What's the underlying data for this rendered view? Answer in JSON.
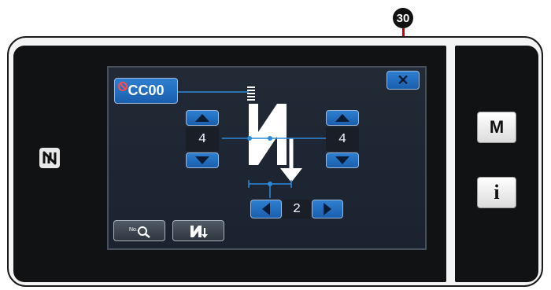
{
  "callout": {
    "number": "30"
  },
  "pattern": {
    "code": "CC00"
  },
  "left_setting": {
    "value": "4"
  },
  "right_setting": {
    "value": "4"
  },
  "bottom_setting": {
    "value": "2"
  },
  "close_button": {
    "symbol": "✕"
  },
  "side_panel": {
    "mode_label": "M",
    "info_label": "i"
  },
  "icons": {
    "nfc": "nfc-icon",
    "search": "pattern-search-icon",
    "stitch": "stitch-shape-icon",
    "prohibit": "prohibit-icon"
  },
  "colors": {
    "accent_blue": "#2e7fd0",
    "line_blue": "#2d8ad9",
    "callout_red": "#d10000"
  }
}
